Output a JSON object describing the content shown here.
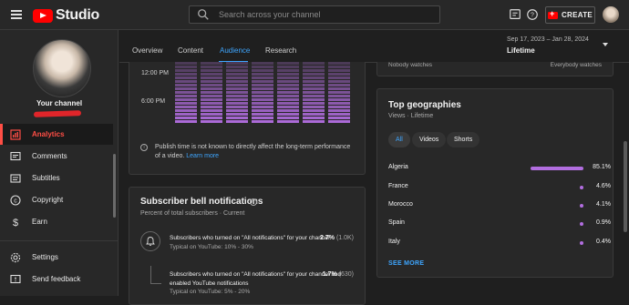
{
  "header": {
    "brand": "Studio",
    "search_placeholder": "Search across your channel",
    "create_label": "CREATE"
  },
  "sidebar": {
    "channel_label": "Your channel",
    "items": [
      {
        "label": "Analytics",
        "icon": "analytics-icon",
        "active": true
      },
      {
        "label": "Comments",
        "icon": "comments-icon"
      },
      {
        "label": "Subtitles",
        "icon": "subtitles-icon"
      },
      {
        "label": "Copyright",
        "icon": "copyright-icon"
      },
      {
        "label": "Earn",
        "icon": "earn-icon"
      },
      {
        "label": "Settings",
        "icon": "gear-icon"
      },
      {
        "label": "Send feedback",
        "icon": "feedback-icon"
      }
    ]
  },
  "tabs": [
    {
      "label": "Overview"
    },
    {
      "label": "Content"
    },
    {
      "label": "Audience",
      "active": true
    },
    {
      "label": "Research"
    }
  ],
  "date_range": {
    "range": "Sep 17, 2023 – Jan 28, 2024",
    "value": "Lifetime"
  },
  "heatmap": {
    "y_labels": [
      "12:00 PM",
      "6:00 PM"
    ],
    "legend_low": "Nobody watches",
    "legend_high": "Everybody watches",
    "note": "Publish time is not known to directly affect the long-term performance of a video.",
    "learn_more": "Learn more"
  },
  "bell": {
    "title": "Subscriber bell notifications",
    "subtitle": "Percent of total subscribers · Current",
    "rows": [
      {
        "text": "Subscribers who turned on \"All notifications\" for your channel",
        "typical": "Typical on YouTube: 10% - 30%",
        "pct": "2.7%",
        "count": "(1.0K)"
      },
      {
        "text": "Subscribers who turned on \"All notifications\" for your channel and enabled YouTube notifications",
        "typical": "Typical on YouTube: 5% - 20%",
        "pct": "1.7%",
        "count": "(630)"
      }
    ]
  },
  "geographies": {
    "title": "Top geographies",
    "subtitle": "Views · Lifetime",
    "chips": [
      "All",
      "Videos",
      "Shorts"
    ],
    "active_chip": "All",
    "rows": [
      {
        "country": "Algeria",
        "pct": "85.1%",
        "value": 85.1
      },
      {
        "country": "France",
        "pct": "4.6%",
        "value": 4.6
      },
      {
        "country": "Morocco",
        "pct": "4.1%",
        "value": 4.1
      },
      {
        "country": "Spain",
        "pct": "0.9%",
        "value": 0.9
      },
      {
        "country": "Italy",
        "pct": "0.4%",
        "value": 0.4
      }
    ],
    "see_more": "SEE MORE",
    "bar_color": "#b26ee0"
  },
  "colors": {
    "accent": "#3ea6ff",
    "active_nav": "#ff4e45",
    "brand_red": "#ff0000"
  }
}
